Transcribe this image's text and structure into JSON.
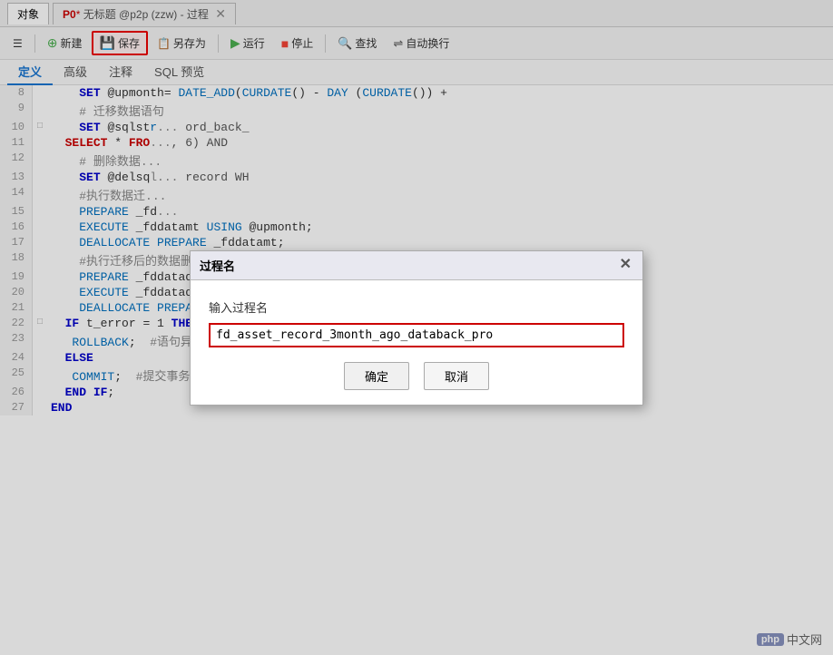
{
  "titlebar": {
    "object_tab": "对象",
    "proc_tab_prefix": "P0",
    "proc_tab_dot": "*",
    "proc_tab_title": "无标题 @p2p (zzw) - 过程",
    "close_char": "✕"
  },
  "toolbar": {
    "new_label": "新建",
    "save_label": "保存",
    "saveas_label": "另存为",
    "run_label": "运行",
    "stop_label": "停止",
    "find_label": "查找",
    "autowrap_label": "自动换行"
  },
  "subtabs": {
    "tab1": "定义",
    "tab2": "高级",
    "tab3": "注释",
    "tab4": "SQL 预览"
  },
  "dialog": {
    "title": "过程名",
    "label": "输入过程名",
    "input_value": "fd_asset_record_3month_ago_databack_pro",
    "confirm_label": "确定",
    "cancel_label": "取消"
  },
  "watermark": {
    "badge": "php",
    "text": "中文网"
  },
  "code": {
    "lines": [
      {
        "num": "8",
        "exp": "",
        "content": "    SET @upmonth= DATE_ADD(CURDATE() - DAY (CURDATE()) +"
      },
      {
        "num": "9",
        "exp": "",
        "content": "    # 迁移数据语句"
      },
      {
        "num": "10",
        "exp": "□",
        "content": "    SET @sqlst..."
      },
      {
        "num": "11",
        "exp": "",
        "content": "  SELECT * FRO..."
      },
      {
        "num": "12",
        "exp": "",
        "content": "    # 删除数据..."
      },
      {
        "num": "13",
        "exp": "",
        "content": "    SET @delsq..."
      },
      {
        "num": "14",
        "exp": "",
        "content": "    #执行数据迁..."
      },
      {
        "num": "15",
        "exp": "",
        "content": "    PREPARE _fd..."
      },
      {
        "num": "16",
        "exp": "",
        "content": "    EXECUTE _fddatamt USING @upmonth;"
      },
      {
        "num": "17",
        "exp": "",
        "content": "    DEALLOCATE PREPARE _fddatamt;"
      },
      {
        "num": "18",
        "exp": "",
        "content": "    #执行迁移后的数据删除"
      },
      {
        "num": "19",
        "exp": "",
        "content": "    PREPARE _fddatadel FROM @delsqlstr;"
      },
      {
        "num": "20",
        "exp": "",
        "content": "    EXECUTE _fddatadel USING @upmonth;"
      },
      {
        "num": "21",
        "exp": "",
        "content": "    DEALLOCATE PREPARE _fddatadel;"
      },
      {
        "num": "22",
        "exp": "□",
        "content": "  IF t_error = 1 THEN"
      },
      {
        "num": "23",
        "exp": "",
        "content": "   ROLLBACK;  #语句异常-回滚"
      },
      {
        "num": "24",
        "exp": "",
        "content": "  ELSE"
      },
      {
        "num": "25",
        "exp": "",
        "content": "   COMMIT;  #提交事务"
      },
      {
        "num": "26",
        "exp": "",
        "content": "  END IF;"
      },
      {
        "num": "27",
        "exp": "",
        "content": "END"
      }
    ]
  }
}
